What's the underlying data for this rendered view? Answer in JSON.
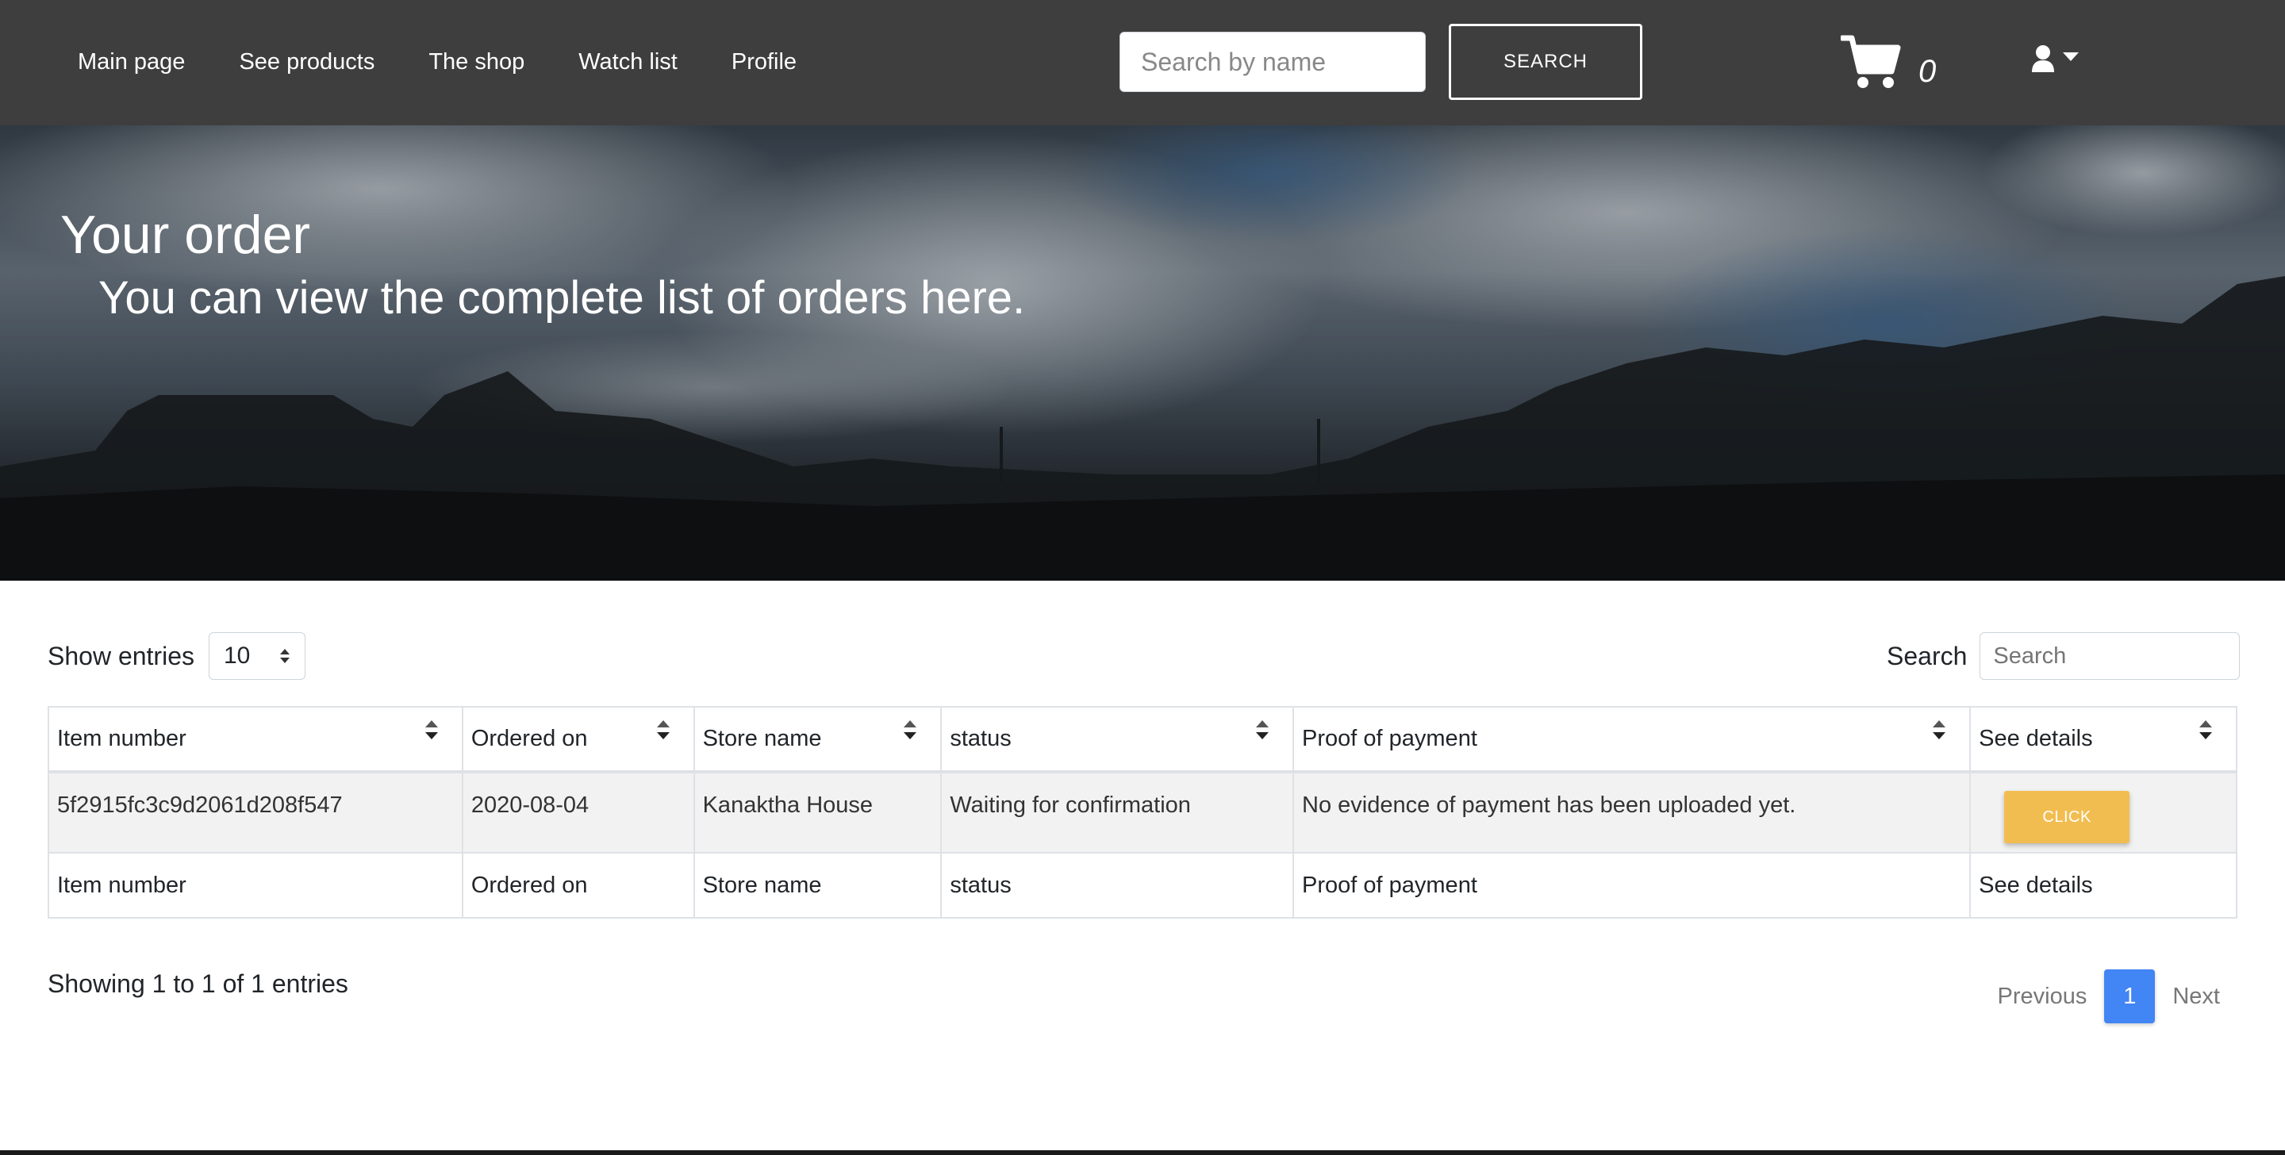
{
  "navbar": {
    "links": [
      "Main page",
      "See products",
      "The shop",
      "Watch list",
      "Profile"
    ],
    "search_placeholder": "Search by name",
    "search_button": "SEARCH",
    "cart_count": "0",
    "cart_icon": "shopping-cart-icon",
    "user_icon": "user-icon"
  },
  "hero": {
    "title": "Your order",
    "subtitle": "You can view the complete list of orders here."
  },
  "controls": {
    "show_entries_label": "Show entries",
    "entries_value": "10",
    "search_label": "Search",
    "search_placeholder": "Search"
  },
  "table": {
    "headers": [
      "Item number",
      "Ordered on",
      "Store name",
      "status",
      "Proof of payment",
      "See details"
    ],
    "rows": [
      {
        "item_number": "5f2915fc3c9d2061d208f547",
        "ordered_on": "2020-08-04",
        "store_name": "Kanaktha House",
        "status": "Waiting for confirmation",
        "proof_of_payment": "No evidence of payment has been uploaded yet.",
        "details_button": "CLICK"
      }
    ],
    "footers": [
      "Item number",
      "Ordered on",
      "Store name",
      "status",
      "Proof of payment",
      "See details"
    ]
  },
  "footer": {
    "showing_text": "Showing 1 to 1 of 1 entries",
    "previous": "Previous",
    "current_page": "1",
    "next": "Next"
  },
  "colors": {
    "navbar_bg": "#3e3e3e",
    "button_accent": "#f2bd50",
    "page_active": "#4285f4"
  }
}
